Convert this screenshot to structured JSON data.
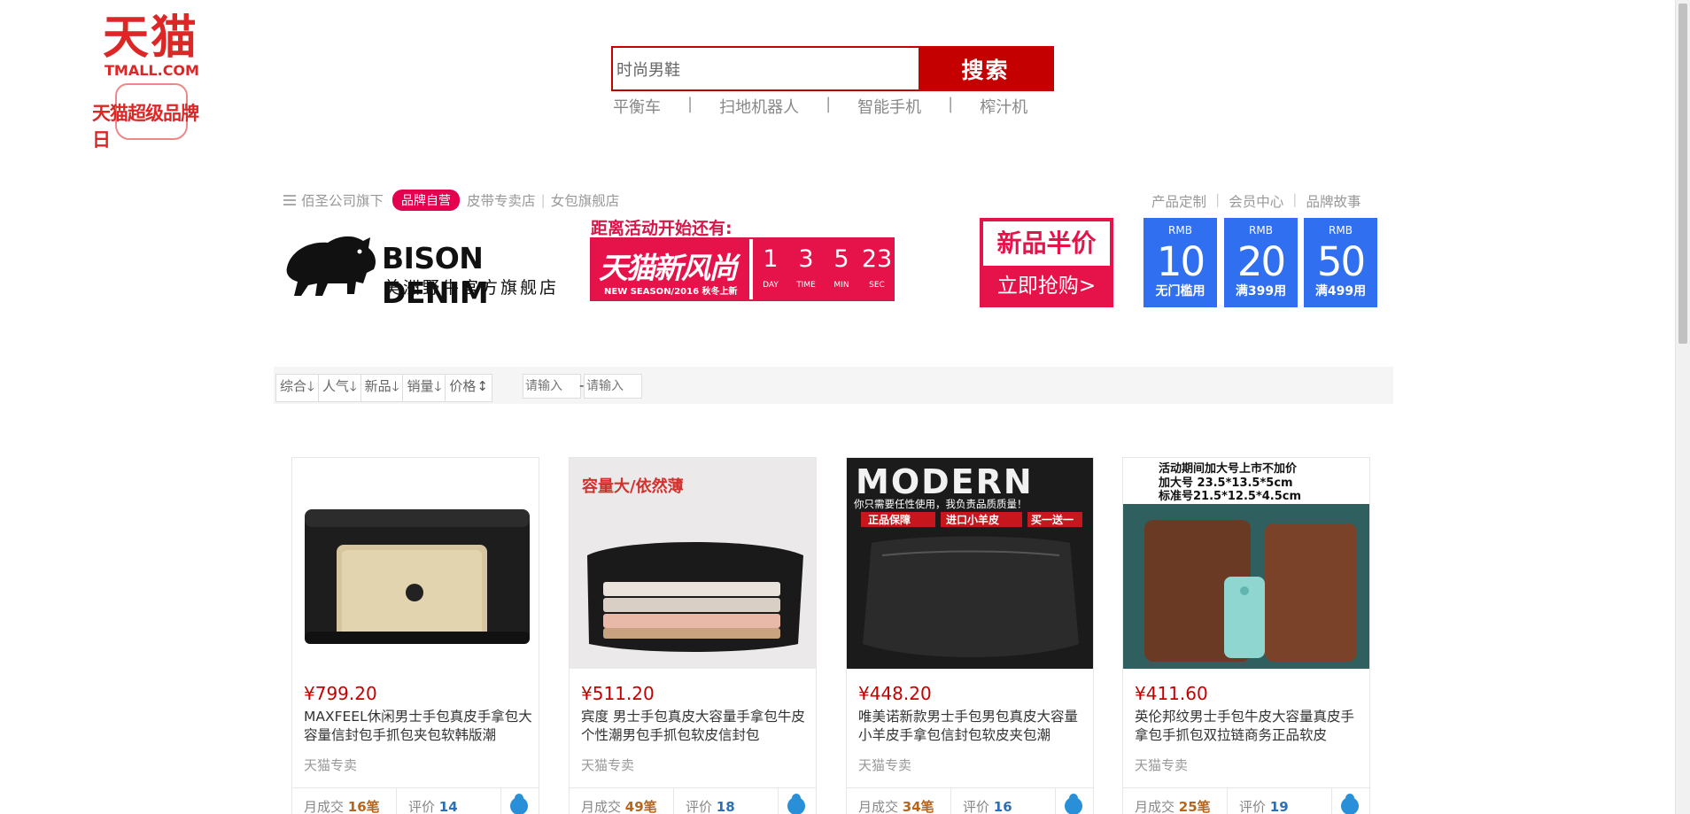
{
  "header": {
    "logo_main": "天猫",
    "logo_url": "TMALL.COM",
    "logo_sub": "天猫超级品牌日",
    "search": {
      "value": "时尚男鞋",
      "button_label": "搜索"
    },
    "hot_words": [
      "平衡车",
      "扫地机器人",
      "智能手机",
      "榨汁机"
    ],
    "hot_word_separator": "|"
  },
  "shop": {
    "company": "佰圣公司旗下",
    "self_badge": "品牌自营",
    "sub_shops": [
      "皮带专卖店",
      "女包旗舰店"
    ],
    "brand_name": "BISON DENIM",
    "brand_sub": "美洲野牛官方旗舰店",
    "links": [
      "产品定制",
      "会员中心",
      "品牌故事"
    ],
    "countdown": {
      "title": "距离活动开始还有:",
      "brand": "天猫新风尚",
      "season": "NEW SEASON/2016 秋冬上新",
      "cells": [
        {
          "num": "1",
          "label": "DAY"
        },
        {
          "num": "3",
          "label": "TIME"
        },
        {
          "num": "5",
          "label": "MIN"
        },
        {
          "num": "23",
          "label": "SEC"
        }
      ]
    },
    "half_price": {
      "top": "新品半价",
      "bottom": "立即抢购>"
    },
    "coupons": [
      {
        "rmb": "RMB",
        "amount": "10",
        "condition": "无门槛用"
      },
      {
        "rmb": "RMB",
        "amount": "20",
        "condition": "满399用"
      },
      {
        "rmb": "RMB",
        "amount": "50",
        "condition": "满499用"
      }
    ]
  },
  "sort_bar": {
    "items": [
      {
        "label": "综合",
        "arrow": "🡓"
      },
      {
        "label": "人气",
        "arrow": "🡓"
      },
      {
        "label": "新品",
        "arrow": "🡓"
      },
      {
        "label": "销量",
        "arrow": "🡓"
      },
      {
        "label": "价格",
        "arrow": "↕"
      }
    ],
    "price_min_placeholder": "请输入",
    "price_dash": "-",
    "price_max_placeholder": "请输入"
  },
  "products": [
    {
      "price": "¥799.20",
      "title": "MAXFEEL休闲男士手包真皮手拿包大容量信封包手抓包夹包软韩版潮",
      "shop_tag": "天猫专卖",
      "sales_label": "月成交",
      "sales": "16笔",
      "reviews_label": "评价",
      "reviews": "14",
      "image": {
        "theme": "black clutch with gold tablet",
        "bg": "#ffffff"
      }
    },
    {
      "price": "¥511.20",
      "title": "宾度 男士手包真皮大容量手拿包牛皮个性潮男包手抓包软皮信封包",
      "shop_tag": "天猫专卖",
      "sales_label": "月成交",
      "sales": "49笔",
      "reviews_label": "评价",
      "reviews": "18",
      "image": {
        "caption": "容量大/依然薄",
        "theme": "open black clutch",
        "bg": "#ebe9ea"
      }
    },
    {
      "price": "¥448.20",
      "title": "唯美诺新款男士手包男包真皮大容量小羊皮手拿包信封包软皮夹包潮",
      "shop_tag": "天猫专卖",
      "sales_label": "月成交",
      "sales": "34笔",
      "reviews_label": "评价",
      "reviews": "16",
      "image": {
        "caption": "MODERN",
        "line1": "你只需要任性使用，我负责品质质量！",
        "tags": [
          "正品保障",
          "进口小羊皮",
          "买一送一"
        ],
        "theme": "black leather pouch",
        "bg": "#1b1b1b"
      }
    },
    {
      "price": "¥411.60",
      "title": "英伦邦纹男士手包牛皮大容量真皮手拿包手抓包双拉链商务正品软皮",
      "shop_tag": "天猫专卖",
      "sales_label": "月成交",
      "sales": "25笔",
      "reviews_label": "评价",
      "reviews": "19",
      "image": {
        "caption": "活动期间加大号上市不加价",
        "line1": "加大号 23.5*13.5*5cm",
        "line2": "标准号21.5*12.5*4.5cm",
        "theme": "brown wallets with phone",
        "bg": "#2f5f5e"
      }
    }
  ],
  "colors": {
    "tmall_red": "#dd2727",
    "search_red": "#c40000",
    "promo_pink": "#e5134a",
    "coupon_blue": "#2f6ff0"
  }
}
